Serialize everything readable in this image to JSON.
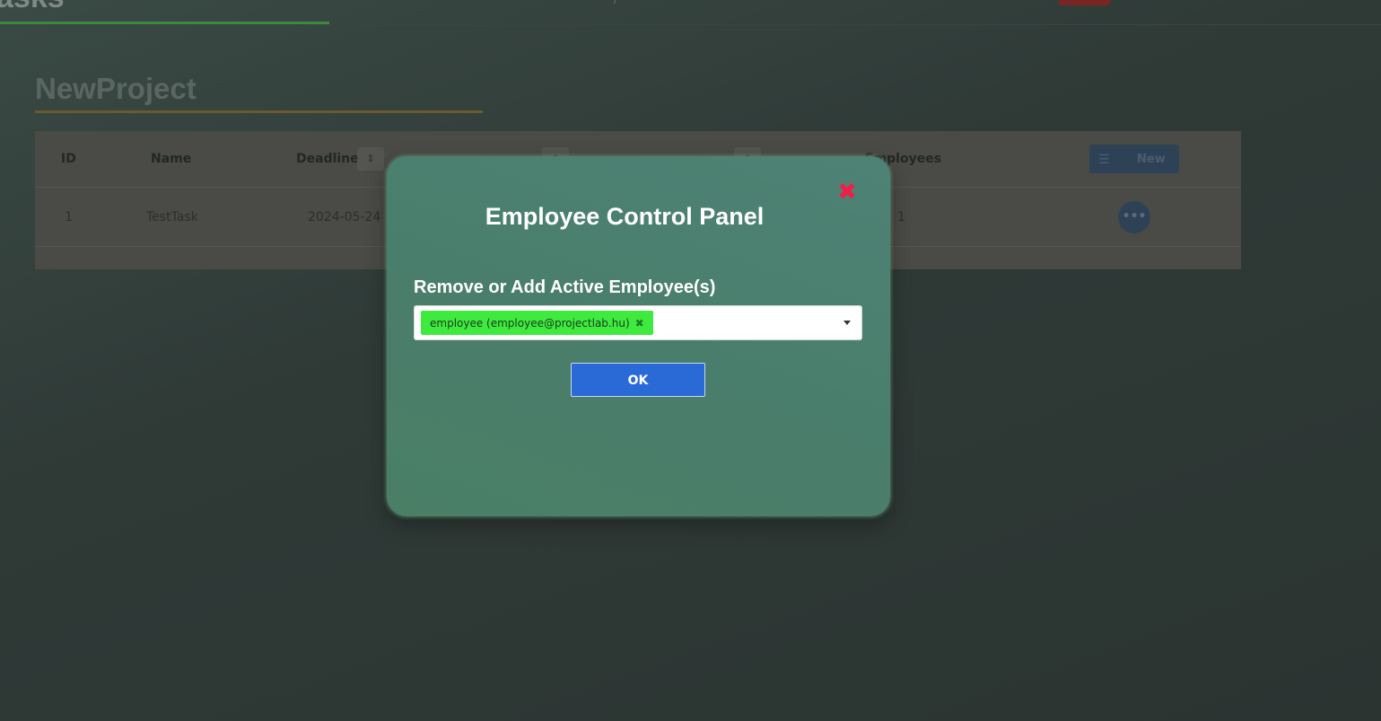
{
  "nav": {
    "tasks_title": "asks",
    "tick": "/"
  },
  "project": {
    "title": "NewProject"
  },
  "table": {
    "headers": {
      "id": "ID",
      "name": "Name",
      "deadline": "Deadline",
      "employees": "Employees"
    },
    "sort_icon": "sort-icon",
    "new_button": {
      "label": "New",
      "icon": "list-icon"
    },
    "rows": [
      {
        "id": "1",
        "name": "TestTask",
        "deadline": "2024-05-24",
        "employees": "1",
        "actions_icon": "more-icon"
      }
    ]
  },
  "modal": {
    "title": "Employee Control Panel",
    "close_icon": "close-icon",
    "field_label": "Remove or Add Active Employee(s)",
    "selected": [
      {
        "label": "employee (employee@projectlab.hu)",
        "remove_glyph": "✖"
      }
    ],
    "ok_label": "OK"
  },
  "colors": {
    "modal_bg": "#4a7e6c",
    "close": "#ef1f4a",
    "chip": "#3eea3e",
    "ok": "#2a6ad6"
  }
}
